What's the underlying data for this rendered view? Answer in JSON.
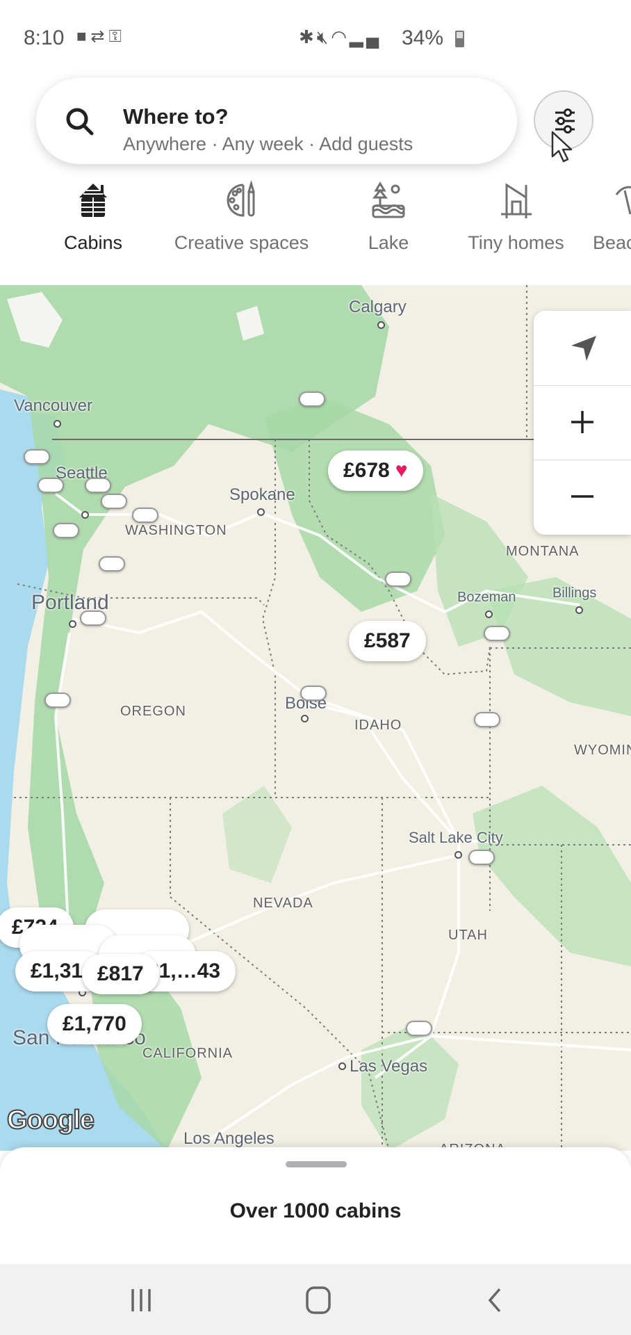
{
  "status_bar": {
    "time": "8:10",
    "left_icons": [
      "video-icon",
      "sync-icon",
      "vpn-key-icon"
    ],
    "right_icons": [
      "bluetooth-icon",
      "mute-icon",
      "wifi-icon",
      "signal-icon"
    ],
    "battery": "34%"
  },
  "search": {
    "title": "Where to?",
    "subtitle": "Anywhere · Any week · Add guests",
    "filter_icon": "sliders-icon"
  },
  "categories": [
    {
      "label": "Cabins",
      "icon": "cabin-icon",
      "active": true
    },
    {
      "label": "Creative spaces",
      "icon": "palette-icon",
      "active": false
    },
    {
      "label": "Lake",
      "icon": "lake-icon",
      "active": false
    },
    {
      "label": "Tiny homes",
      "icon": "tiny-home-icon",
      "active": false
    },
    {
      "label": "Beach",
      "icon": "beach-icon",
      "active": false
    }
  ],
  "map": {
    "labels": {
      "calgary": "Calgary",
      "vancouver": "Vancouver",
      "seattle": "Seattle",
      "spokane": "Spokane",
      "washington": "WASHINGTON",
      "montana": "MONTANA",
      "bozeman": "Bozeman",
      "billings": "Billings",
      "portland": "Portland",
      "oregon": "OREGON",
      "boise": "Boise",
      "idaho": "IDAHO",
      "wyoming": "WYOMING",
      "salt_lake_city": "Salt Lake City",
      "nevada": "NEVADA",
      "utah": "UTAH",
      "san_francisco": "San Francisco",
      "california": "CALIFORNIA",
      "las_vegas": "Las Vegas",
      "los_angeles": "Los Angeles",
      "arizona": "ARIZONA"
    },
    "price_pins": [
      {
        "price": "£678",
        "favorited": true
      },
      {
        "price": "£587",
        "favorited": false
      },
      {
        "price": "£724",
        "favorited": false
      },
      {
        "price": "£1,31…",
        "favorited": false
      },
      {
        "price": "£817",
        "favorited": false
      },
      {
        "price": "£1,…43",
        "favorited": false
      },
      {
        "price": "£1,770",
        "favorited": false
      }
    ],
    "attribution": "Google",
    "controls": {
      "locate": "navigation-arrow-icon",
      "zoom_in": "+",
      "zoom_out": "−"
    }
  },
  "results": {
    "count_text": "Over 1000 cabins"
  },
  "nav_bar": {
    "recent": "recent-apps-icon",
    "home": "home-icon",
    "back": "back-icon"
  }
}
